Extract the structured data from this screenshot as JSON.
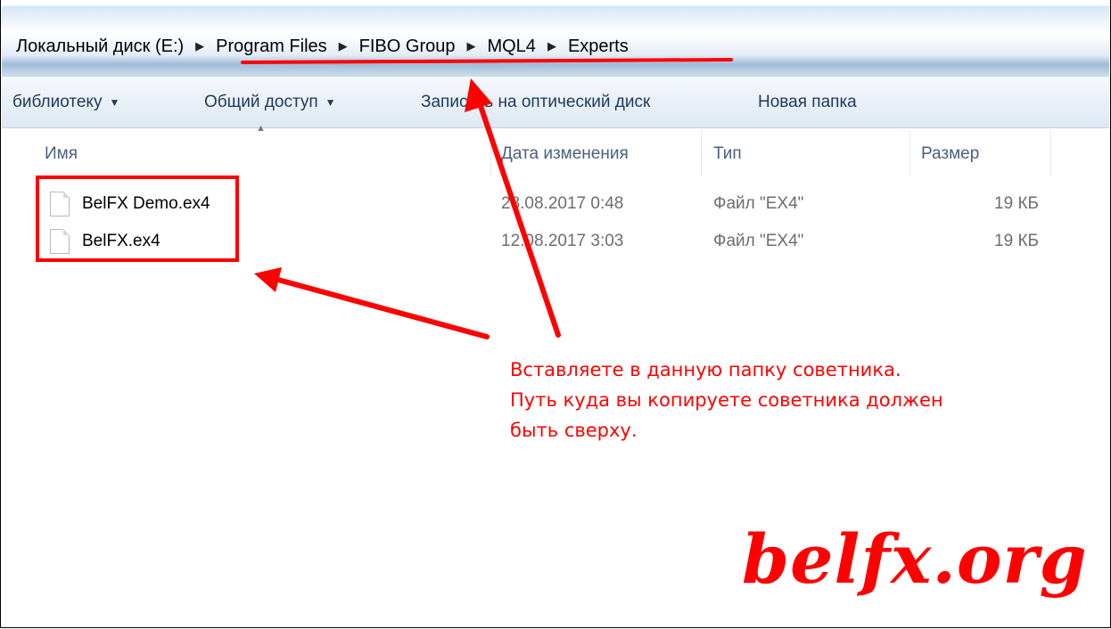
{
  "address_bar": {
    "crumbs": [
      "Локальный диск (E:)",
      "Program Files",
      "FIBO Group",
      "MQL4",
      "Experts"
    ]
  },
  "toolbar": {
    "library_label": "библиотеку",
    "share_label": "Общий доступ",
    "burn_label": "Записать на оптический диск",
    "new_folder_label": "Новая папка"
  },
  "columns": {
    "name": "Имя",
    "date": "Дата изменения",
    "type": "Тип",
    "size": "Размер"
  },
  "files": [
    {
      "name": "BelFX Demo.ex4",
      "date": "28.08.2017 0:48",
      "type": "Файл \"EX4\"",
      "size": "19 КБ"
    },
    {
      "name": "BelFX.ex4",
      "date": "12.08.2017 3:03",
      "type": "Файл \"EX4\"",
      "size": "19 КБ"
    }
  ],
  "annotation": {
    "lines": [
      "Вставляете в данную папку советника.",
      "Путь куда вы копируете советника должен",
      "быть сверху."
    ],
    "color": "#ff0000"
  },
  "watermark": "belfx.org"
}
